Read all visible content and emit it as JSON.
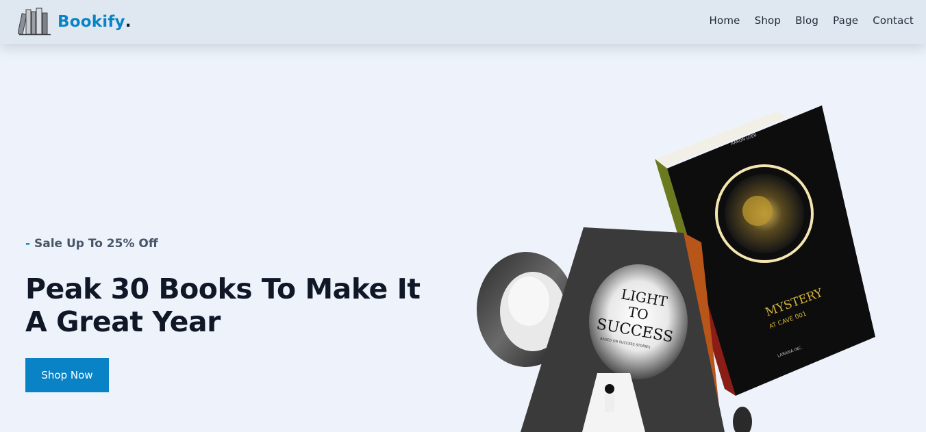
{
  "navbar": {
    "brand_name": "Bookify",
    "brand_dot": ".",
    "logo_icon": "books-icon",
    "links": [
      {
        "label": "Home"
      },
      {
        "label": "Shop"
      },
      {
        "label": "Blog"
      },
      {
        "label": "Page"
      },
      {
        "label": "Contact"
      }
    ]
  },
  "hero": {
    "subtitle_dash": "-",
    "subtitle": "Sale Up To 25% Off",
    "title": "Peak 30 Books To Make It A Great Year",
    "cta_label": "Shop Now",
    "books": {
      "front": {
        "title_line1": "LIGHT",
        "title_line2": "TO",
        "title_line3": "SUCCESS",
        "tagline": "BASED ON SUCCESS STORIES"
      },
      "back": {
        "author": "AARON LOEB",
        "title_line1": "MYSTERY",
        "title_line2": "AT CAVE 001",
        "publisher": "LARANA INC."
      }
    }
  },
  "colors": {
    "accent": "#0a83c6",
    "heading": "#101828",
    "background": "#eef3fb",
    "navbar": "#dfe8f0"
  }
}
